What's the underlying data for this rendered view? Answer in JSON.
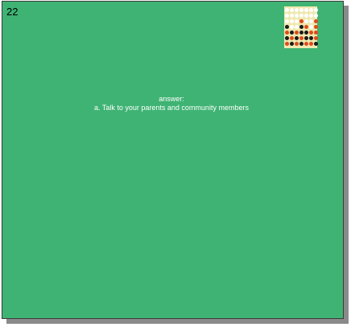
{
  "slide": {
    "number": "22",
    "answer_heading": "answer:",
    "answer_text": "a. Talk to your parents and community members"
  },
  "colors": {
    "background": "#3fb373",
    "board": "#efe9b0"
  },
  "thumbnail": {
    "icon": "connect-four-board-icon",
    "rows": [
      [
        "empty",
        "empty",
        "empty",
        "empty",
        "empty",
        "empty",
        "empty"
      ],
      [
        "empty",
        "empty",
        "empty",
        "empty",
        "empty",
        "empty",
        "empty"
      ],
      [
        "empty",
        "empty",
        "empty",
        "red",
        "empty",
        "empty",
        "red"
      ],
      [
        "black",
        "empty",
        "empty",
        "black",
        "red",
        "empty",
        "red"
      ],
      [
        "red",
        "black",
        "red",
        "black",
        "black",
        "red",
        "red"
      ],
      [
        "black",
        "red",
        "black",
        "red",
        "black",
        "black",
        "red"
      ],
      [
        "red",
        "black",
        "red",
        "black",
        "red",
        "red",
        "black"
      ]
    ]
  }
}
